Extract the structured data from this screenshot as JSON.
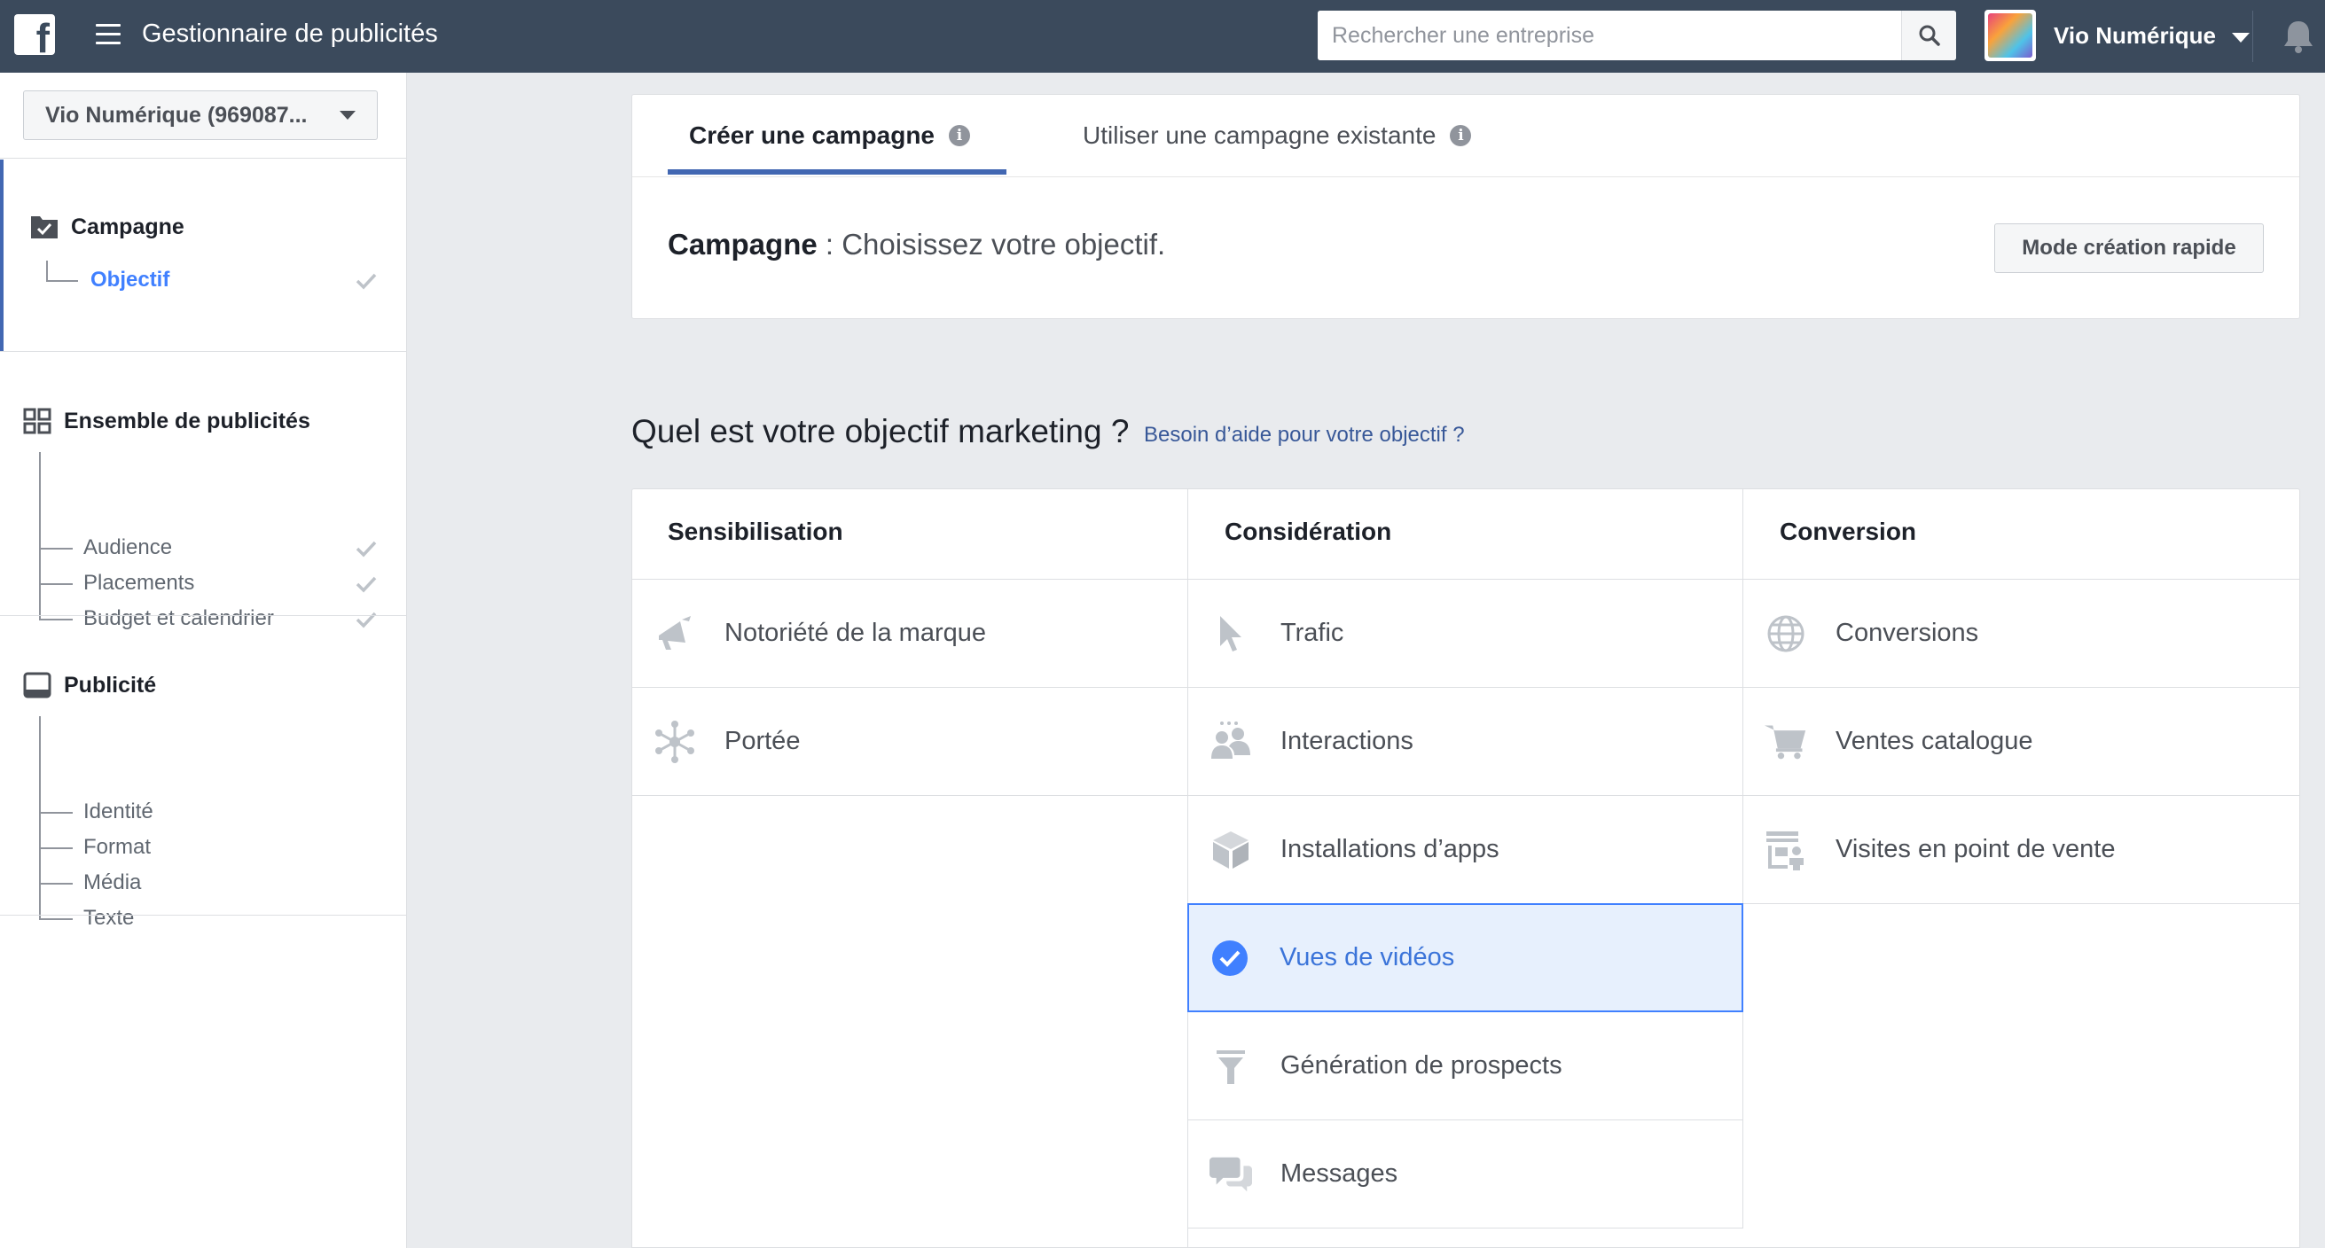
{
  "topbar": {
    "logo": "f",
    "app_title": "Gestionnaire de publicités",
    "search_placeholder": "Rechercher une entreprise",
    "account_name": "Vio Numérique"
  },
  "sidebar": {
    "account_selector": "Vio Numérique (969087...",
    "sections": [
      {
        "title": "Campagne",
        "items": [
          {
            "label": "Objectif",
            "active": true,
            "done": true
          }
        ]
      },
      {
        "title": "Ensemble de publicités",
        "items": [
          {
            "label": "Audience",
            "done": true
          },
          {
            "label": "Placements",
            "done": true
          },
          {
            "label": "Budget et calendrier",
            "done": true
          }
        ]
      },
      {
        "title": "Publicité",
        "items": [
          {
            "label": "Identité"
          },
          {
            "label": "Format"
          },
          {
            "label": "Média"
          },
          {
            "label": "Texte"
          }
        ]
      }
    ]
  },
  "campaign_panel": {
    "tabs": [
      {
        "label": "Créer une campagne",
        "active": true
      },
      {
        "label": "Utiliser une campagne existante",
        "active": false
      }
    ],
    "heading_bold": "Campagne",
    "heading_rest": " : Choisissez votre objectif.",
    "quick_mode_button": "Mode création rapide"
  },
  "objectives": {
    "question": "Quel est votre objectif marketing ?",
    "help_link": "Besoin d’aide pour votre objectif ?",
    "columns": [
      {
        "title": "Sensibilisation",
        "items": [
          {
            "label": "Notoriété de la marque",
            "icon": "megaphone-icon"
          },
          {
            "label": "Portée",
            "icon": "reach-icon"
          }
        ]
      },
      {
        "title": "Considération",
        "items": [
          {
            "label": "Trafic",
            "icon": "cursor-icon"
          },
          {
            "label": "Interactions",
            "icon": "people-icon"
          },
          {
            "label": "Installations d’apps",
            "icon": "box-icon"
          },
          {
            "label": "Vues de vidéos",
            "icon": "check-circle-icon",
            "selected": true
          },
          {
            "label": "Génération de prospects",
            "icon": "funnel-icon"
          },
          {
            "label": "Messages",
            "icon": "chat-bubbles-icon"
          }
        ]
      },
      {
        "title": "Conversion",
        "items": [
          {
            "label": "Conversions",
            "icon": "globe-icon"
          },
          {
            "label": "Ventes catalogue",
            "icon": "cart-icon"
          },
          {
            "label": "Visites en point de vente",
            "icon": "store-icon"
          }
        ]
      }
    ]
  },
  "colors": {
    "topbar": "#3b4a5c",
    "accent": "#4267b2",
    "selected_bg": "#e7f0fd",
    "selected_border": "#4080ff"
  }
}
